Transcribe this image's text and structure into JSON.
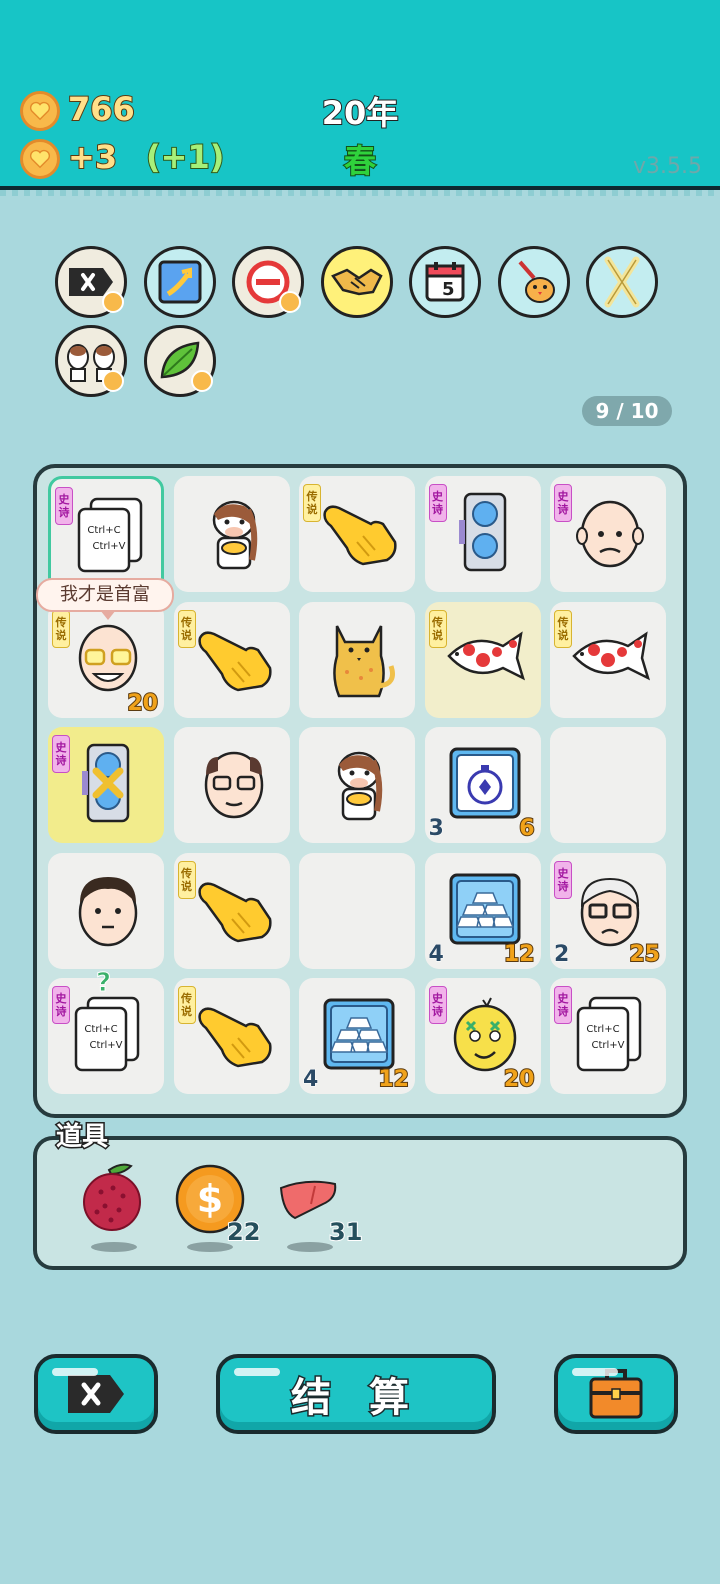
{
  "header": {
    "coins": "766",
    "income": "+3",
    "bonus": "(+1)",
    "year": "20年",
    "season": "春",
    "version": "v3.5.5"
  },
  "relics": {
    "items": [
      "remove-ticket-icon",
      "upgrade-arrow-icon",
      "minus-circle-icon",
      "handshake-icon",
      "calendar-icon",
      "syringe-chick-icon",
      "crossed-sticks-icon",
      "twin-cows-icon",
      "leaf-icon"
    ],
    "calendar_day": "5"
  },
  "counter": "9 / 10",
  "bubble": "我才是首富",
  "tags": {
    "epic": "史诗",
    "legend": "传说"
  },
  "grid": {
    "cells": [
      {
        "icon": "copy-paste-card-icon",
        "tag": "epic",
        "left": "",
        "right": "",
        "text1": "Ctrl+C",
        "text2": "Ctrl+V"
      },
      {
        "icon": "cow-with-gold-icon",
        "tag": "",
        "left": "",
        "right": ""
      },
      {
        "icon": "pointing-hand-icon",
        "tag": "legend",
        "left": "",
        "right": ""
      },
      {
        "icon": "graphics-card-icon",
        "tag": "epic",
        "left": "",
        "right": ""
      },
      {
        "icon": "bald-man-worried-icon",
        "tag": "epic",
        "left": "",
        "right": ""
      },
      {
        "icon": "rich-man-glasses-icon",
        "tag": "legend",
        "left": "",
        "right": "20"
      },
      {
        "icon": "pointing-hand-icon",
        "tag": "legend",
        "left": "",
        "right": ""
      },
      {
        "icon": "cat-icon",
        "tag": "",
        "left": "",
        "right": ""
      },
      {
        "icon": "koi-fish-icon",
        "tag": "legend",
        "left": "",
        "right": ""
      },
      {
        "icon": "koi-fish-icon",
        "tag": "legend",
        "left": "",
        "right": ""
      },
      {
        "icon": "graphics-card-crossed-icon",
        "tag": "epic",
        "left": "",
        "right": ""
      },
      {
        "icon": "man-glasses-icon",
        "tag": "",
        "left": "",
        "right": ""
      },
      {
        "icon": "cow-with-gold-icon",
        "tag": "",
        "left": "",
        "right": ""
      },
      {
        "icon": "stopwatch-box-icon",
        "tag": "",
        "left": "3",
        "right": "6"
      },
      {
        "icon": "",
        "tag": "",
        "left": "",
        "right": ""
      },
      {
        "icon": "young-man-icon",
        "tag": "",
        "left": "",
        "right": ""
      },
      {
        "icon": "pointing-hand-icon",
        "tag": "legend",
        "left": "",
        "right": ""
      },
      {
        "icon": "",
        "tag": "",
        "left": "",
        "right": ""
      },
      {
        "icon": "gold-bars-icon",
        "tag": "",
        "left": "4",
        "right": "12"
      },
      {
        "icon": "old-man-glasses-icon",
        "tag": "epic",
        "left": "2",
        "right": "25"
      },
      {
        "icon": "copy-paste-card-icon",
        "tag": "epic",
        "left": "",
        "right": "",
        "text1": "Ctrl+C",
        "text2": "Ctrl+V",
        "mark": "?"
      },
      {
        "icon": "pointing-hand-icon",
        "tag": "legend",
        "left": "",
        "right": ""
      },
      {
        "icon": "gold-bars-icon",
        "tag": "",
        "left": "4",
        "right": "12"
      },
      {
        "icon": "dizzy-fruit-icon",
        "tag": "epic",
        "left": "",
        "right": "20"
      },
      {
        "icon": "copy-paste-card-icon",
        "tag": "epic",
        "left": "",
        "right": "",
        "text1": "Ctrl+C",
        "text2": "Ctrl+V"
      }
    ]
  },
  "props": {
    "title": "道具",
    "items": [
      {
        "icon": "bayberry-icon",
        "count": ""
      },
      {
        "icon": "dollar-coin-icon",
        "count": "22"
      },
      {
        "icon": "liver-icon",
        "count": "31"
      }
    ]
  },
  "buttons": {
    "settle_label": "结 算"
  },
  "colors": {
    "header": "#17c5c6",
    "background": "#a9d8dd",
    "button": "#1ec4c5",
    "coin_text": "#ffe08a"
  }
}
